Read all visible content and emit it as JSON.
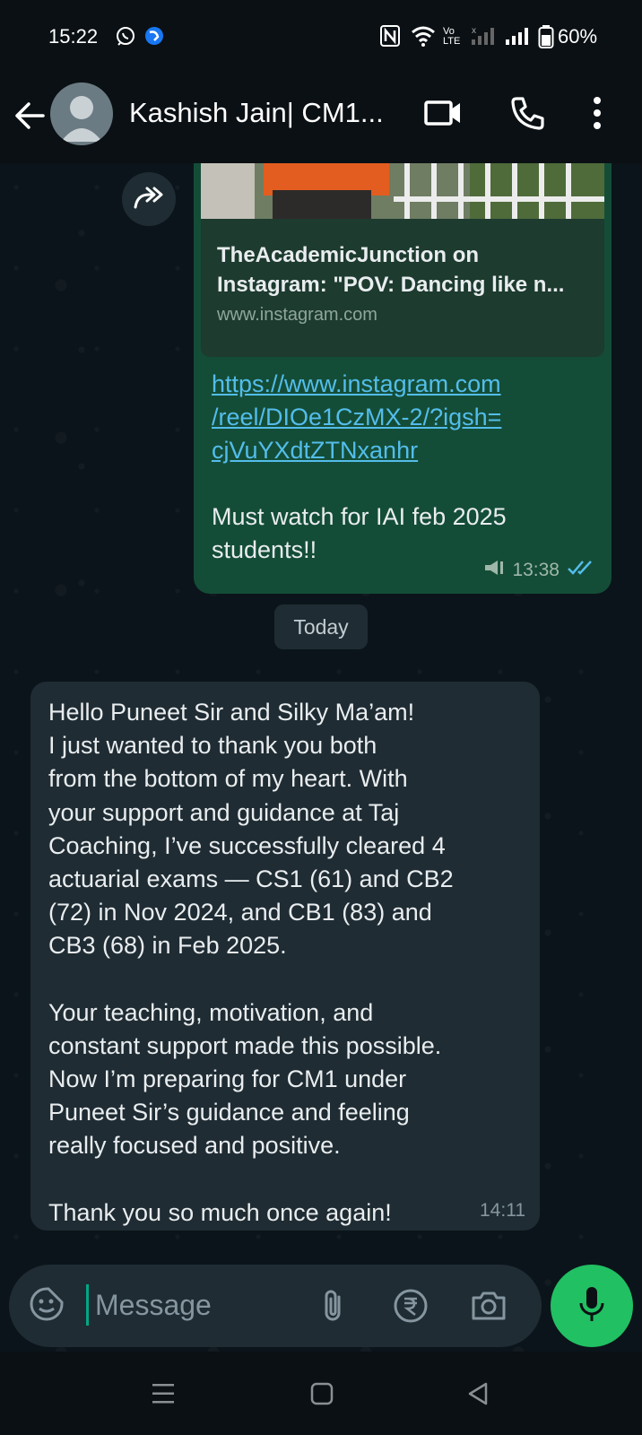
{
  "status_bar": {
    "time": "15:22",
    "battery_percent": "60%",
    "icons": [
      "whatsapp-status-icon",
      "meta-app-icon",
      "nfc-icon",
      "wifi-icon",
      "volte-icon",
      "signal-sim1-icon",
      "signal-sim2-icon",
      "battery-icon"
    ]
  },
  "header": {
    "contact_name": "Kashish Jain| CM1...",
    "icons": [
      "back-arrow-icon",
      "avatar",
      "video-call-icon",
      "voice-call-icon",
      "more-menu-icon"
    ]
  },
  "messages": {
    "outgoing": {
      "preview_title_line1": "TheAcademicJunction on",
      "preview_title_line2": "Instagram: \"POV: Dancing like n...",
      "preview_domain": "www.instagram.com",
      "link_lines": [
        "https://www.instagram.com",
        "/reel/DIOe1CzMX-2/?igsh=",
        "cjVuYXdtZTNxanhr"
      ],
      "text_line1": "Must watch for IAI feb 2025",
      "text_line2": "students!!",
      "time": "13:38",
      "status": "read"
    },
    "date_chip": "Today",
    "incoming": {
      "lines": [
        "Hello Puneet Sir and Silky Ma’am!",
        "I just wanted to thank you both",
        "from the bottom of my heart. With",
        "your support and guidance at Taj",
        "Coaching, I’ve successfully cleared 4",
        "actuarial exams — CS1 (61) and CB2",
        "(72) in Nov 2024, and CB1 (83) and",
        "CB3 (68) in Feb 2025.",
        "",
        "Your teaching, motivation, and",
        "constant support made this possible.",
        "Now I’m preparing for CM1 under",
        "Puneet Sir’s guidance and feeling",
        "really focused and positive.",
        "",
        "Thank you so much once again!"
      ],
      "time": "14:11"
    }
  },
  "composer": {
    "placeholder": "Message",
    "icons": [
      "sticker-icon",
      "attach-icon",
      "rupee-payment-icon",
      "camera-icon",
      "mic-icon"
    ]
  },
  "nav_bar": {
    "icons": [
      "recents-icon",
      "home-icon",
      "back-nav-icon"
    ]
  },
  "colors": {
    "background": "#0b141a",
    "outgoing_bubble": "#144d37",
    "incoming_bubble": "#1f2c33",
    "link": "#53bdeb",
    "accent_green": "#21c063",
    "read_ticks": "#53bdeb"
  }
}
